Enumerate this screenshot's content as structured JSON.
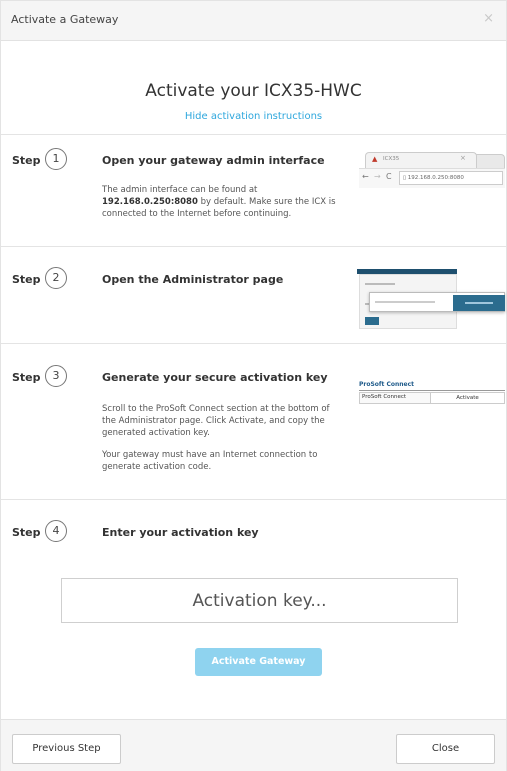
{
  "header": {
    "title": "Activate a Gateway",
    "close_glyph": "×"
  },
  "main": {
    "title": "Activate your ICX35-HWC",
    "hide_link": "Hide activation instructions"
  },
  "steps": [
    {
      "word": "Step",
      "number": "1",
      "title": "Open your gateway admin interface",
      "desc_prefix": "The admin interface can be found at",
      "desc_bold": "192.168.0.250:8080",
      "desc_suffix": "by default. Make sure the ICX is connected to the Internet before continuing.",
      "thumbnail": {
        "tab_label": "ICX35",
        "url": "192.168.0.250:8080"
      }
    },
    {
      "word": "Step",
      "number": "2",
      "title": "Open the Administrator page"
    },
    {
      "word": "Step",
      "number": "3",
      "title": "Generate your secure activation key",
      "desc1": "Scroll to the ProSoft Connect section at the bottom of the Administrator page. Click Activate, and copy the generated activation key.",
      "desc2": "Your gateway must have an Internet connection to generate activation code.",
      "thumbnail": {
        "section_title": "ProSoft Connect",
        "row_label": "ProSoft Connect",
        "button_label": "Activate"
      }
    },
    {
      "word": "Step",
      "number": "4",
      "title": "Enter your activation key"
    }
  ],
  "activation": {
    "placeholder": "Activation key...",
    "button_label": "Activate Gateway"
  },
  "footer": {
    "previous_label": "Previous Step",
    "close_label": "Close"
  },
  "colors": {
    "link": "#2ea7dd",
    "activate_button_disabled": "#8fd3ef",
    "warning_icon": "#c0392b"
  },
  "icons": [
    "close-icon",
    "warning-icon",
    "back-icon",
    "forward-icon",
    "reload-icon",
    "page-icon"
  ]
}
